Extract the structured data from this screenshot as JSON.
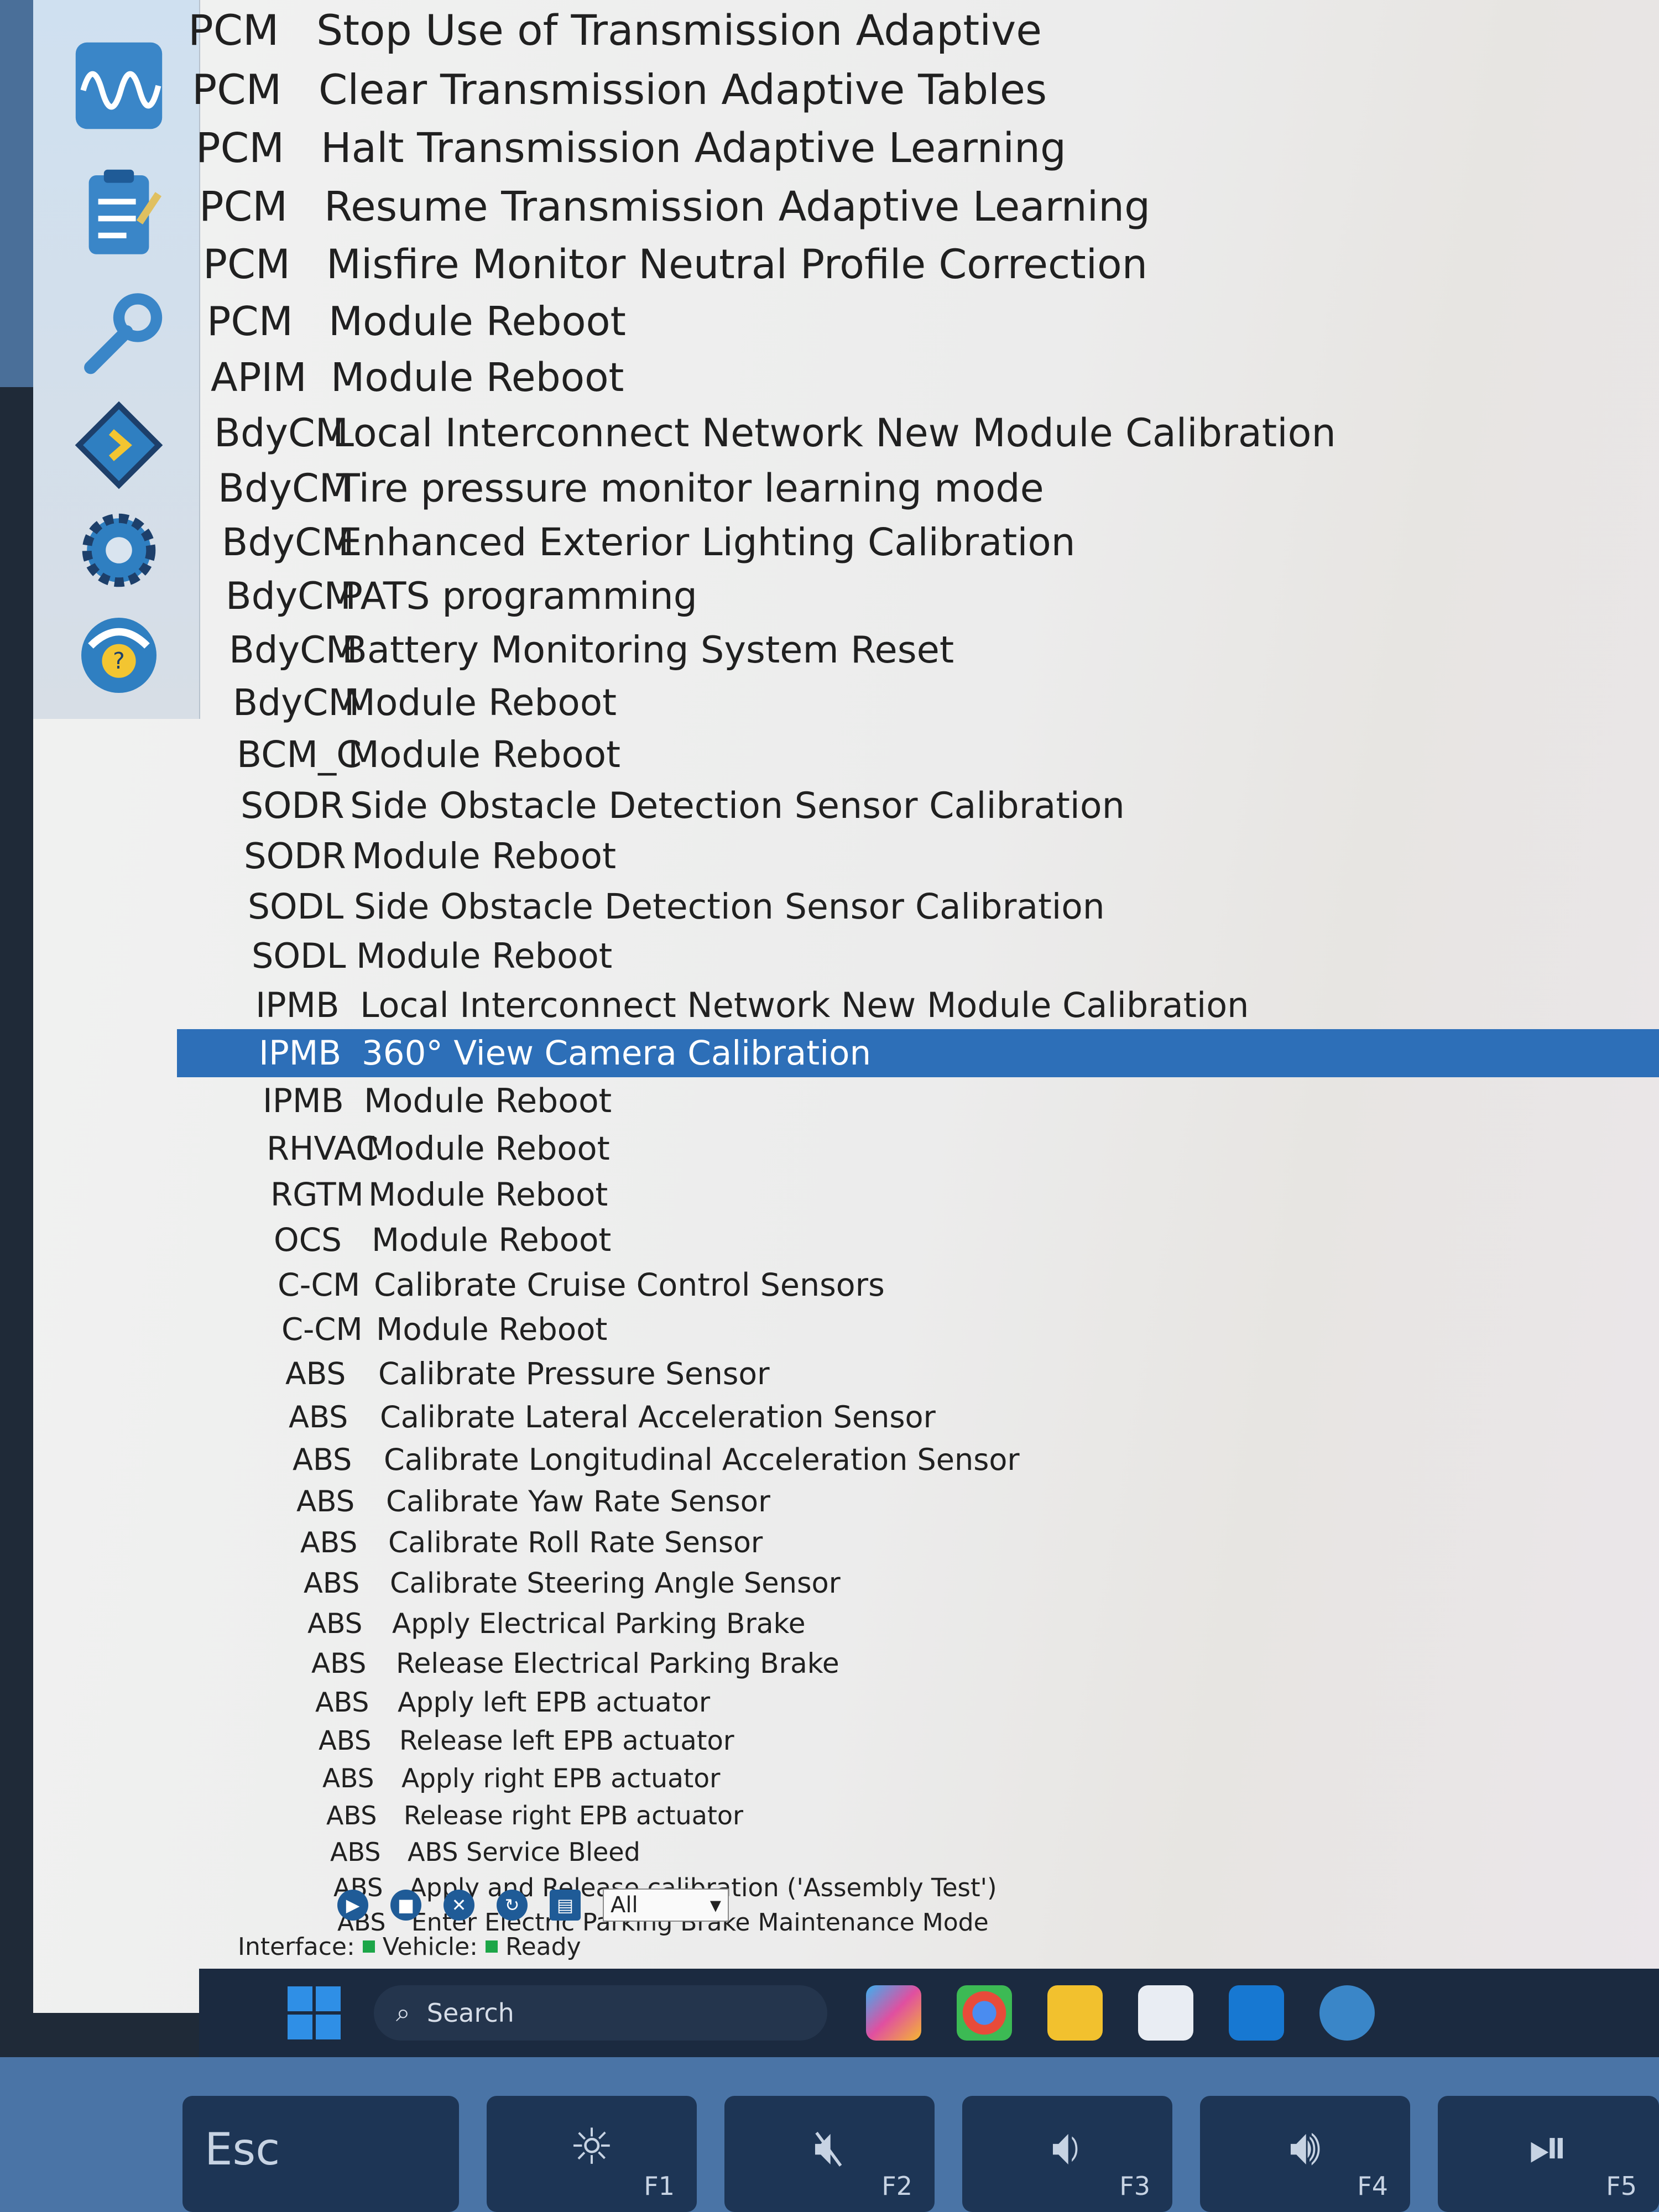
{
  "procedures": [
    {
      "module": "PCM",
      "name": "Stop Use of Transmission Adaptive"
    },
    {
      "module": "PCM",
      "name": "Clear Transmission Adaptive Tables"
    },
    {
      "module": "PCM",
      "name": "Halt Transmission Adaptive Learning"
    },
    {
      "module": "PCM",
      "name": "Resume Transmission Adaptive Learning"
    },
    {
      "module": "PCM",
      "name": "Misfire Monitor Neutral Profile Correction"
    },
    {
      "module": "PCM",
      "name": "Module Reboot"
    },
    {
      "module": "APIM",
      "name": "Module Reboot"
    },
    {
      "module": "BdyCM",
      "name": "Local Interconnect Network New Module Calibration"
    },
    {
      "module": "BdyCM",
      "name": "Tire pressure monitor learning mode"
    },
    {
      "module": "BdyCM",
      "name": "Enhanced Exterior Lighting Calibration"
    },
    {
      "module": "BdyCM",
      "name": "PATS programming"
    },
    {
      "module": "BdyCM",
      "name": "Battery Monitoring System Reset"
    },
    {
      "module": "BdyCM",
      "name": "Module Reboot"
    },
    {
      "module": "BCM_C",
      "name": "Module Reboot"
    },
    {
      "module": "SODR",
      "name": "Side Obstacle Detection Sensor Calibration"
    },
    {
      "module": "SODR",
      "name": "Module Reboot"
    },
    {
      "module": "SODL",
      "name": "Side Obstacle Detection Sensor Calibration"
    },
    {
      "module": "SODL",
      "name": "Module Reboot"
    },
    {
      "module": "IPMB",
      "name": "Local Interconnect Network New Module Calibration"
    },
    {
      "module": "IPMB",
      "name": "360° View Camera Calibration",
      "selected": true
    },
    {
      "module": "IPMB",
      "name": "Module Reboot"
    },
    {
      "module": "RHVAC",
      "name": "Module Reboot"
    },
    {
      "module": "RGTM",
      "name": "Module Reboot"
    },
    {
      "module": "OCS",
      "name": "Module Reboot"
    },
    {
      "module": "C-CM",
      "name": "Calibrate Cruise Control Sensors"
    },
    {
      "module": "C-CM",
      "name": "Module Reboot"
    },
    {
      "module": "ABS",
      "name": "Calibrate Pressure Sensor"
    },
    {
      "module": "ABS",
      "name": "Calibrate Lateral Acceleration Sensor"
    },
    {
      "module": "ABS",
      "name": "Calibrate Longitudinal Acceleration Sensor"
    },
    {
      "module": "ABS",
      "name": "Calibrate Yaw Rate Sensor"
    },
    {
      "module": "ABS",
      "name": "Calibrate Roll Rate Sensor"
    },
    {
      "module": "ABS",
      "name": "Calibrate Steering Angle Sensor"
    },
    {
      "module": "ABS",
      "name": "Apply Electrical Parking Brake"
    },
    {
      "module": "ABS",
      "name": "Release Electrical Parking Brake"
    },
    {
      "module": "ABS",
      "name": "Apply left EPB actuator"
    },
    {
      "module": "ABS",
      "name": "Release left EPB actuator"
    },
    {
      "module": "ABS",
      "name": "Apply right EPB actuator"
    },
    {
      "module": "ABS",
      "name": "Release right EPB actuator"
    },
    {
      "module": "ABS",
      "name": "ABS Service Bleed"
    },
    {
      "module": "ABS",
      "name": "Apply and Release calibration ('Assembly Test')"
    },
    {
      "module": "ABS",
      "name": "Enter Electric Parking Brake Maintenance Mode"
    }
  ],
  "toolstrip": [
    "waveform-icon",
    "checklist-icon",
    "wrench-icon",
    "module-chip-icon",
    "gear-icon",
    "help-icon"
  ],
  "toolbar": {
    "filter_value": "All"
  },
  "status": {
    "interface_label": "Interface:",
    "vehicle_label": "Vehicle:",
    "ready_label": "Ready",
    "indicator_color": "#1ca648"
  },
  "taskbar": {
    "search_label": "Search"
  },
  "keys": {
    "esc": "Esc",
    "f1": "F1",
    "f2": "F2",
    "f3": "F3",
    "f4": "F4",
    "f5": "F5"
  },
  "colors": {
    "selection": "#2d6fb8",
    "taskbar": "#1b2a40",
    "accent": "#1f5b97"
  }
}
